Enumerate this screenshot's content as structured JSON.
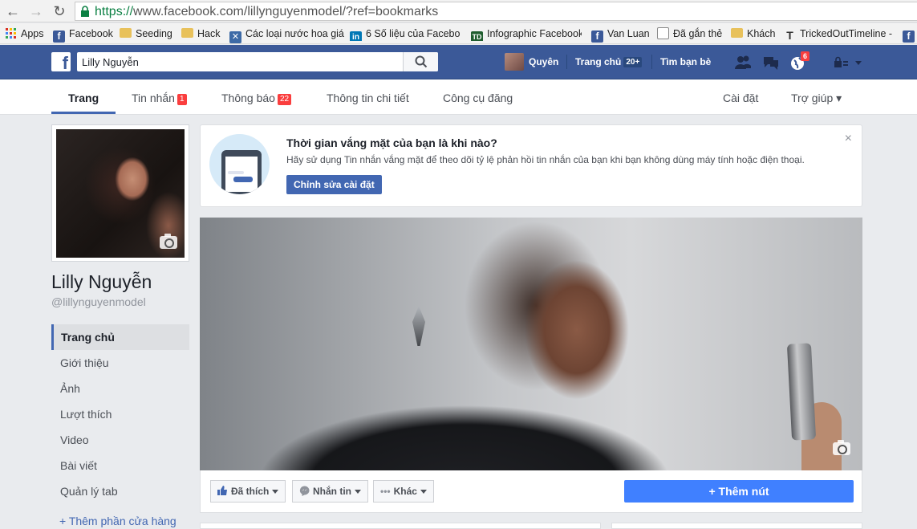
{
  "browser": {
    "url_scheme": "https://",
    "url_rest": "www.facebook.com/lillynguyenmodel/?ref=bookmarks",
    "bookmarks": [
      {
        "label": "Apps",
        "icon": "apps-grid-icon"
      },
      {
        "label": "Facebook",
        "icon": "facebook-icon"
      },
      {
        "label": "Seeding",
        "icon": "folder-icon"
      },
      {
        "label": "Hack",
        "icon": "folder-icon"
      },
      {
        "label": "Các loại nước hoa giá",
        "icon": "site-icon"
      },
      {
        "label": "6 Số liệu của Faceboo",
        "icon": "linkedin-icon"
      },
      {
        "label": "Infographic Facebook",
        "icon": "td-icon"
      },
      {
        "label": "Van Luan",
        "icon": "facebook-icon"
      },
      {
        "label": "Đã gắn thẻ",
        "icon": "document-icon"
      },
      {
        "label": "Khách",
        "icon": "folder-icon"
      },
      {
        "label": "TrickedOutTimeline -",
        "icon": "t-icon"
      }
    ]
  },
  "fb_bar": {
    "search_value": "Lilly Nguyễn",
    "user_name": "Quyên",
    "home_label": "Trang chủ",
    "home_count": "20+",
    "find_friends": "Tìm bạn bè",
    "notif_count": "6"
  },
  "page_tabs": {
    "page": "Trang",
    "messages": "Tin nhắn",
    "messages_count": "1",
    "notifications": "Thông báo",
    "notifications_count": "22",
    "insights": "Thông tin chi tiết",
    "publishing": "Công cụ đăng",
    "settings": "Cài đặt",
    "help": "Trợ giúp ▾"
  },
  "profile": {
    "name": "Lilly Nguyễn",
    "handle": "@lillynguyenmodel"
  },
  "side_nav": [
    {
      "label": "Trang chủ",
      "active": true
    },
    {
      "label": "Giới thiệu"
    },
    {
      "label": "Ảnh"
    },
    {
      "label": "Lượt thích"
    },
    {
      "label": "Video"
    },
    {
      "label": "Bài viết"
    },
    {
      "label": "Quản lý tab"
    }
  ],
  "side_add": "+ Thêm phần cửa hàng",
  "notice": {
    "title": "Thời gian vắng mặt của bạn là khi nào?",
    "text": "Hãy sử dụng Tin nhắn vắng mặt để theo dõi tỷ lệ phản hồi tin nhắn của bạn khi bạn không dùng máy tính hoặc điện thoại.",
    "button": "Chỉnh sửa cài đặt",
    "close": "×"
  },
  "actions": {
    "like": "Đã thích",
    "message": "Nhắn tin",
    "more": "Khác",
    "add_button": "+ Thêm nút"
  },
  "colors": {
    "fb_blue": "#3b5998",
    "link_blue": "#4267b2",
    "add_button": "#4080ff",
    "badge_red": "#fa3e3e"
  }
}
